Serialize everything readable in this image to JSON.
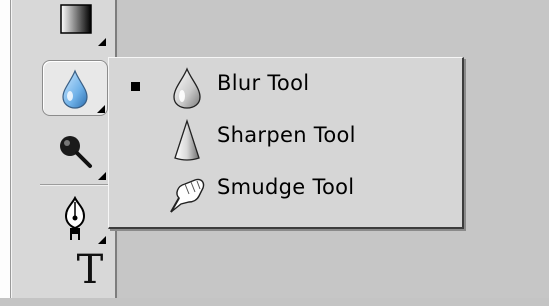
{
  "toolbar": {
    "tools": [
      {
        "name": "gradient-tool",
        "icon": "gradient-icon",
        "selected": false,
        "has_flyout": true
      },
      {
        "name": "blur-tool",
        "icon": "blur-drop-icon",
        "selected": true,
        "has_flyout": true
      },
      {
        "name": "dodge-tool",
        "icon": "dodge-icon",
        "selected": false,
        "has_flyout": true
      },
      {
        "name": "pen-tool",
        "icon": "pen-nib-icon",
        "selected": false,
        "has_flyout": true
      },
      {
        "name": "type-tool",
        "icon": "type-icon",
        "selected": false,
        "glyph": "T"
      }
    ]
  },
  "flyout_menu": {
    "items": [
      {
        "label": "Blur Tool",
        "icon": "blur-drop-icon",
        "active": true
      },
      {
        "label": "Sharpen Tool",
        "icon": "sharpen-cone-icon",
        "active": false
      },
      {
        "label": "Smudge Tool",
        "icon": "smudge-finger-icon",
        "active": false
      }
    ]
  },
  "colors": {
    "panel": "#d8d8d8",
    "menu_background": "#d6d6d6",
    "menu_border": "#3c3c3c",
    "canvas": "#c6c6c6",
    "text": "#000000"
  }
}
